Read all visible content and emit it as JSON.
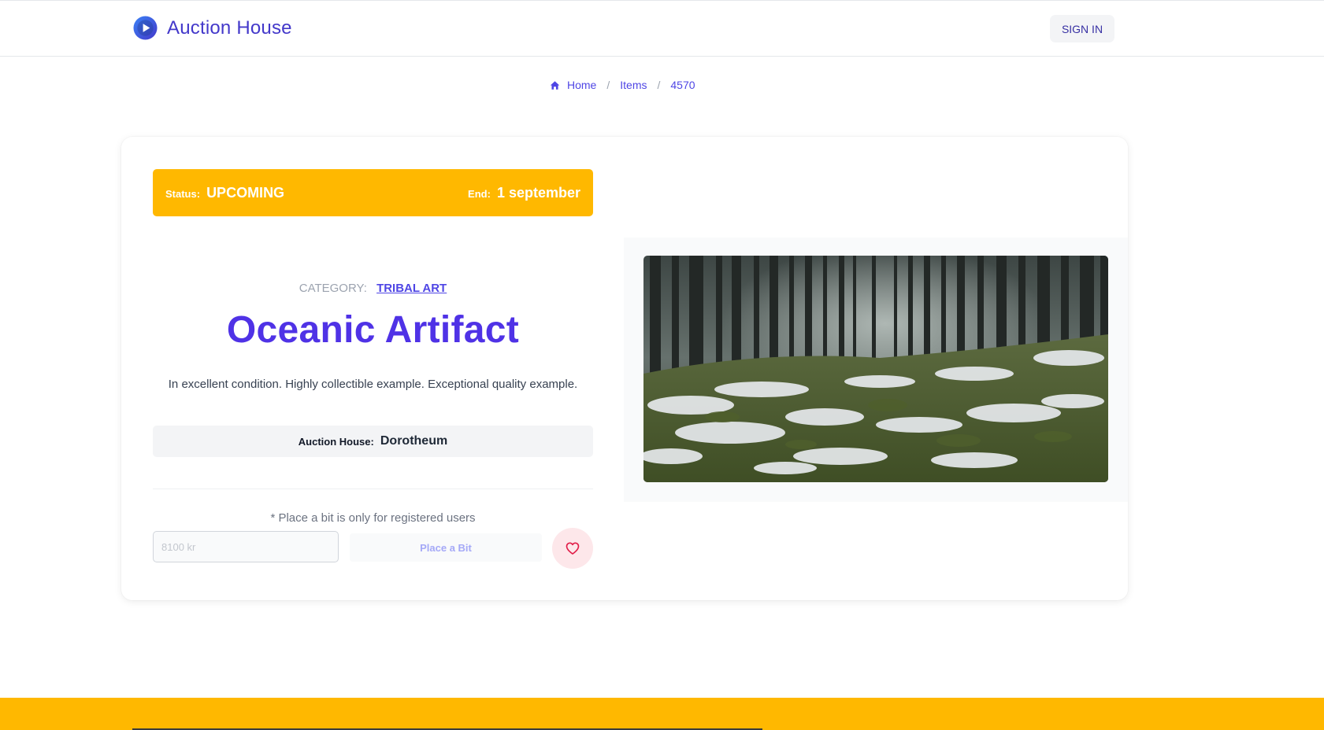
{
  "header": {
    "brand": "Auction House",
    "sign_in_label": "SIGN IN"
  },
  "breadcrumb": {
    "home": "Home",
    "items": "Items",
    "current": "4570",
    "separator": "/"
  },
  "item": {
    "status_label": "Status:",
    "status": "UPCOMING",
    "end_label": "End:",
    "end": "1 september",
    "category_label": "CATEGORY:",
    "category": "TRIBAL ART",
    "title": "Oceanic Artifact",
    "description": "In excellent condition. Highly collectible example. Exceptional quality example.",
    "auction_house_label": "Auction House:",
    "auction_house": "Dorotheum",
    "image_alt": "snowy-forest-photo"
  },
  "bid": {
    "note": "* Place a bit is only for registered users",
    "input_placeholder": "8100 kr",
    "button_label": "Place a Bit"
  },
  "colors": {
    "accent": "#4f46e5",
    "status_bar": "#ffb800",
    "favorite": "#e11d48"
  }
}
